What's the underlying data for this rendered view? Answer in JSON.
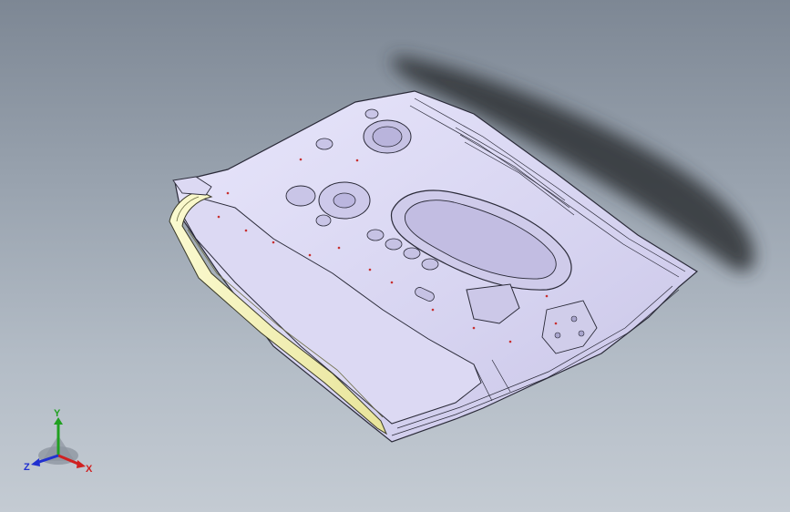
{
  "viewport": {
    "background_top": "#7d8794",
    "background_bottom": "#c4cbd3"
  },
  "model": {
    "part_fill": "#d9d6f2",
    "edge_color": "#2a2a38",
    "seal_fill": "#f2f0a8",
    "shadow_color": "#303338"
  },
  "triad": {
    "x_label": "X",
    "y_label": "Y",
    "z_label": "Z",
    "x_color": "#d02020",
    "y_color": "#20a020",
    "z_color": "#2030d0"
  }
}
